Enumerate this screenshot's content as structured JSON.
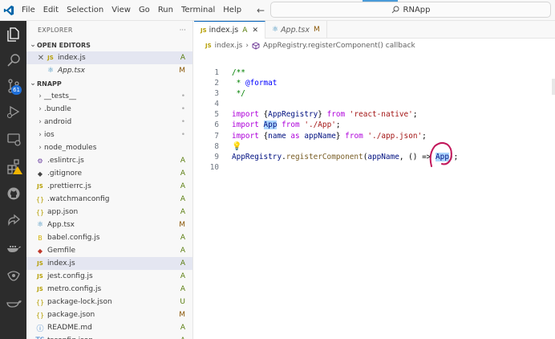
{
  "titlebar": {
    "menu": [
      "File",
      "Edit",
      "Selection",
      "View",
      "Go",
      "Run",
      "Terminal",
      "Help"
    ],
    "search_text": "RNApp"
  },
  "activity": {
    "scm_badge": "61"
  },
  "sidebar": {
    "title": "EXPLORER",
    "more": "···",
    "open_editors_label": "OPEN EDITORS",
    "open_editors": [
      {
        "name": "index.js",
        "status": "A",
        "icon": "js"
      },
      {
        "name": "App.tsx",
        "status": "M",
        "icon": "tsx"
      }
    ],
    "project_label": "RNAPP",
    "tree": [
      {
        "name": "__tests__",
        "type": "folder",
        "status": "•"
      },
      {
        "name": ".bundle",
        "type": "folder",
        "status": "•"
      },
      {
        "name": "android",
        "type": "folder",
        "status": "•"
      },
      {
        "name": "ios",
        "type": "folder",
        "status": "•"
      },
      {
        "name": "node_modules",
        "type": "folder",
        "status": ""
      },
      {
        "name": ".eslintrc.js",
        "type": "file",
        "icon": "⚙",
        "status": "A"
      },
      {
        "name": ".gitignore",
        "type": "file",
        "icon": "◆",
        "status": "A"
      },
      {
        "name": ".prettierrc.js",
        "type": "file",
        "icon": "JS",
        "status": "A"
      },
      {
        "name": ".watchmanconfig",
        "type": "file",
        "icon": "{}",
        "status": "A"
      },
      {
        "name": "app.json",
        "type": "file",
        "icon": "{}",
        "status": "A"
      },
      {
        "name": "App.tsx",
        "type": "file",
        "icon": "⚛",
        "status": "M"
      },
      {
        "name": "babel.config.js",
        "type": "file",
        "icon": "B",
        "status": "A"
      },
      {
        "name": "Gemfile",
        "type": "file",
        "icon": "◆",
        "status": "A"
      },
      {
        "name": "index.js",
        "type": "file",
        "icon": "JS",
        "status": "A",
        "selected": true
      },
      {
        "name": "jest.config.js",
        "type": "file",
        "icon": "JS",
        "status": "A"
      },
      {
        "name": "metro.config.js",
        "type": "file",
        "icon": "JS",
        "status": "A"
      },
      {
        "name": "package-lock.json",
        "type": "file",
        "icon": "{}",
        "status": "U"
      },
      {
        "name": "package.json",
        "type": "file",
        "icon": "{}",
        "status": "M"
      },
      {
        "name": "README.md",
        "type": "file",
        "icon": "ⓘ",
        "status": "A"
      },
      {
        "name": "tsconfig.json",
        "type": "file",
        "icon": "TS",
        "status": "A"
      }
    ]
  },
  "editor": {
    "tabs": [
      {
        "name": "index.js",
        "status": "A",
        "icon": "JS",
        "active": true
      },
      {
        "name": "App.tsx",
        "status": "M",
        "icon": "⚛",
        "active": false
      }
    ],
    "breadcrumb": [
      "index.js",
      "AppRegistry.registerComponent() callback"
    ],
    "lines": [
      {
        "n": "1",
        "tokens": [
          {
            "t": "/**",
            "c": "c-comment"
          }
        ]
      },
      {
        "n": "2",
        "tokens": [
          {
            "t": " * ",
            "c": "c-comment"
          },
          {
            "t": "@format",
            "c": "c-tag"
          }
        ]
      },
      {
        "n": "3",
        "tokens": [
          {
            "t": " */",
            "c": "c-comment"
          }
        ]
      },
      {
        "n": "4",
        "tokens": []
      },
      {
        "n": "5",
        "tokens": [
          {
            "t": "import",
            "c": "c-kw"
          },
          {
            "t": " {",
            "c": "c-plain"
          },
          {
            "t": "AppRegistry",
            "c": "c-var"
          },
          {
            "t": "} ",
            "c": "c-plain"
          },
          {
            "t": "from",
            "c": "c-kw"
          },
          {
            "t": " ",
            "c": "c-plain"
          },
          {
            "t": "'react-native'",
            "c": "c-str"
          },
          {
            "t": ";",
            "c": "c-plain"
          }
        ]
      },
      {
        "n": "6",
        "tokens": [
          {
            "t": "import",
            "c": "c-kw"
          },
          {
            "t": " ",
            "c": "c-plain"
          },
          {
            "t": "App",
            "c": "c-var hl"
          },
          {
            "t": " ",
            "c": "c-plain"
          },
          {
            "t": "from",
            "c": "c-kw"
          },
          {
            "t": " ",
            "c": "c-plain"
          },
          {
            "t": "'./App'",
            "c": "c-str"
          },
          {
            "t": ";",
            "c": "c-plain"
          }
        ]
      },
      {
        "n": "7",
        "tokens": [
          {
            "t": "import",
            "c": "c-kw"
          },
          {
            "t": " {",
            "c": "c-plain"
          },
          {
            "t": "name",
            "c": "c-var"
          },
          {
            "t": " ",
            "c": "c-plain"
          },
          {
            "t": "as",
            "c": "c-kw"
          },
          {
            "t": " ",
            "c": "c-plain"
          },
          {
            "t": "appName",
            "c": "c-var"
          },
          {
            "t": "} ",
            "c": "c-plain"
          },
          {
            "t": "from",
            "c": "c-kw"
          },
          {
            "t": " ",
            "c": "c-plain"
          },
          {
            "t": "'./app.json'",
            "c": "c-str"
          },
          {
            "t": ";",
            "c": "c-plain"
          }
        ]
      },
      {
        "n": "8",
        "tokens": [
          {
            "t": "💡",
            "c": "bulb"
          }
        ]
      },
      {
        "n": "9",
        "tokens": [
          {
            "t": "AppRegistry",
            "c": "c-var"
          },
          {
            "t": ".",
            "c": "c-plain"
          },
          {
            "t": "registerComponent",
            "c": "c-fn"
          },
          {
            "t": "(",
            "c": "c-plain"
          },
          {
            "t": "appName",
            "c": "c-var"
          },
          {
            "t": ", () => ",
            "c": "c-plain"
          },
          {
            "t": "App",
            "c": "c-var hl"
          },
          {
            "t": ");",
            "c": "c-plain"
          }
        ]
      },
      {
        "n": "10",
        "tokens": []
      }
    ]
  }
}
